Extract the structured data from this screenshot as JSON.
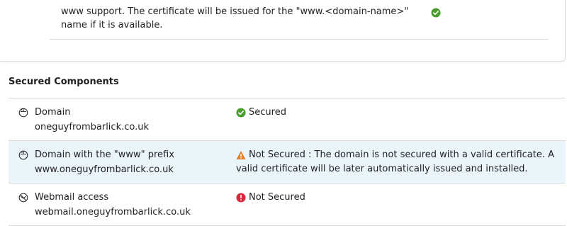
{
  "top": {
    "support_text": "www support. The certificate will be issued for the \"www.<domain-name>\" name if it is available."
  },
  "secured_components": {
    "title": "Secured Components",
    "rows": [
      {
        "name": "Domain",
        "domain": "oneguyfrombarlick.co.uk",
        "icon": "globe-mouse-icon",
        "status": "Secured",
        "status_icon": "check-circle-icon"
      },
      {
        "name": "Domain with the \"www\" prefix",
        "domain": "www.oneguyfrombarlick.co.uk",
        "icon": "globe-mouse-icon",
        "status": "Not Secured : The domain is not secured with a valid certificate. A valid certificate will be later automatically issued and installed.",
        "status_icon": "warning-triangle-icon"
      },
      {
        "name": "Webmail access",
        "domain": "webmail.oneguyfrombarlick.co.uk",
        "icon": "webmail-icon",
        "status": "Not Secured",
        "status_icon": "error-circle-icon"
      }
    ]
  },
  "colors": {
    "success": "#4a9c2d",
    "warning": "#e67e22",
    "error": "#d9293e",
    "highlight_row": "#eaf4fb"
  }
}
